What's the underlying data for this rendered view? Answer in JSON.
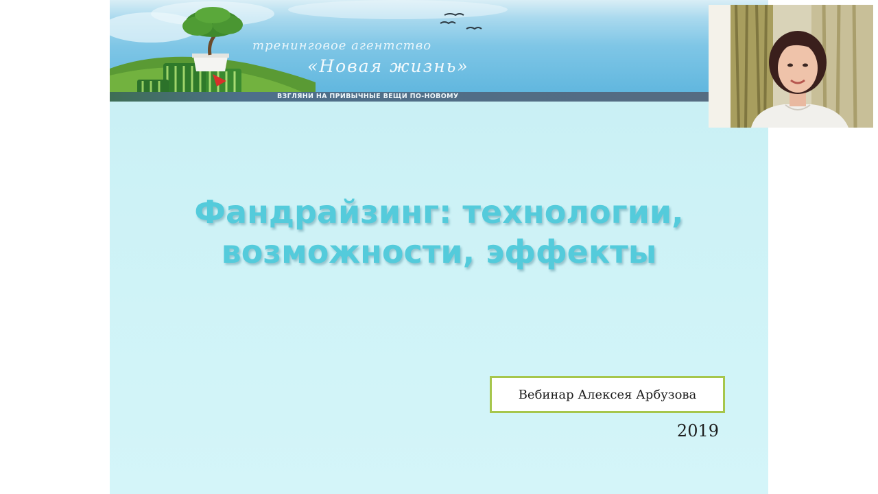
{
  "slide": {
    "agency_line1": "тренинговое агентство",
    "agency_line2": "«Новая жизнь»",
    "tagline": "ВЗГЛЯНИ НА ПРИВЫЧНЫЕ ВЕЩИ ПО-НОВОМУ",
    "title_line1": "Фандрайзинг: технологии,",
    "title_line2": "возможности, эффекты",
    "webinar": "Вебинар Алексея Арбузова",
    "year": "2019"
  },
  "colors": {
    "title": "#54cbdb",
    "background": "#cdf2f6",
    "box_border": "#a6c64c"
  },
  "webcam": {
    "icon": "presenter-video"
  }
}
